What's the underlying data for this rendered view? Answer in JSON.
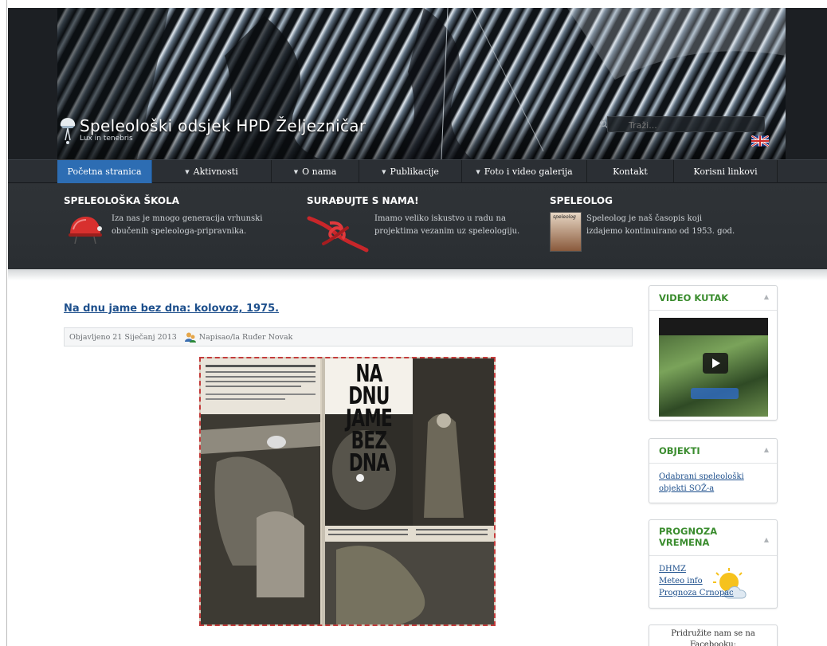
{
  "header": {
    "site_title": "Speleološki odsjek HPD Željezničar",
    "tagline": "Lux in tenebris",
    "search_placeholder": "Traži..."
  },
  "nav": {
    "items": [
      {
        "label": "Početna stranica",
        "dropdown": false,
        "active": true
      },
      {
        "label": "Aktivnosti",
        "dropdown": true,
        "active": false
      },
      {
        "label": "O nama",
        "dropdown": true,
        "active": false
      },
      {
        "label": "Publikacije",
        "dropdown": true,
        "active": false
      },
      {
        "label": "Foto i video galerija",
        "dropdown": true,
        "active": false
      },
      {
        "label": "Kontakt",
        "dropdown": false,
        "active": false
      },
      {
        "label": "Korisni linkovi",
        "dropdown": false,
        "active": false
      }
    ]
  },
  "features": [
    {
      "title": "SPELEOLOŠKA ŠKOLA",
      "text_lines": [
        "Iza nas je mnogo generacija vrhunski",
        "obučenih speleologa-pripravnika."
      ]
    },
    {
      "title": "SURAĐUJTE S NAMA!",
      "text_lines": [
        "Imamo veliko iskustvo u radu na",
        "projektima vezanim uz speleologiju."
      ]
    },
    {
      "title": "SPELEOLOG",
      "text_lines": [
        "Speleolog je naš časopis koji",
        "izdajemo kontinuirano od 1953. god."
      ],
      "cover_label": "speleolog"
    }
  ],
  "article": {
    "title": "Na dnu jame bez dna: kolovoz, 1975.",
    "published": "Objavljeno 21 Siječanj 2013",
    "author": "Napisao/la Ruđer Novak",
    "image_headline": "NA DNU JAME BEZ DNA"
  },
  "sidebar": {
    "video": {
      "title": "VIDEO KUTAK"
    },
    "objekti": {
      "title": "OBJEKTI",
      "links": [
        "Odabrani speleološki",
        "objekti SOŽ-a"
      ]
    },
    "prognoza": {
      "title_lines": [
        "PROGNOZA",
        "VREMENA"
      ],
      "links": [
        "DHMZ",
        "Meteo info",
        "Prognoza Crnopac"
      ]
    },
    "facebook": {
      "lines": [
        "Pridružite nam se na",
        "Facebooku:"
      ]
    }
  },
  "colors": {
    "nav_active": "#2d6db3",
    "widget_title": "#3a8c2e",
    "link": "#1d4f8c",
    "header_bg": "#2b2f34"
  }
}
